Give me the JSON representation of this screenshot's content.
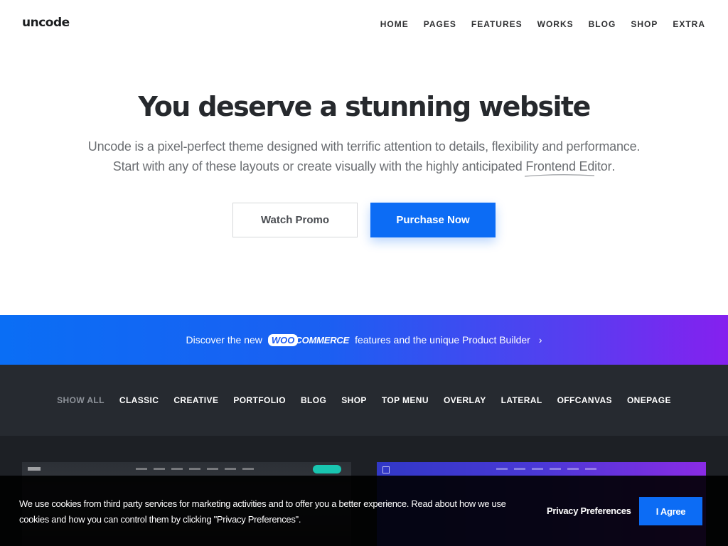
{
  "header": {
    "logo": "uncode",
    "nav": [
      "HOME",
      "PAGES",
      "FEATURES",
      "WORKS",
      "BLOG",
      "SHOP",
      "EXTRA"
    ]
  },
  "hero": {
    "title": "You deserve a stunning website",
    "line1": "Uncode is a pixel-perfect theme designed with terrific attention to details, flexibility and performance.",
    "line2_prefix": "Start with any of these layouts or create visually with the highly anticipated ",
    "line2_link": "Frontend Editor",
    "line2_suffix": ".",
    "btn_promo": "Watch Promo",
    "btn_purchase": "Purchase Now"
  },
  "banner": {
    "prefix": "Discover the new",
    "woo": "WOO",
    "commerce": "COMMERCE",
    "suffix": "features and the unique Product Builder",
    "chevron": "›"
  },
  "filters": [
    "SHOW ALL",
    "CLASSIC",
    "CREATIVE",
    "PORTFOLIO",
    "BLOG",
    "SHOP",
    "TOP MENU",
    "OVERLAY",
    "LATERAL",
    "OFFCANVAS",
    "ONEPAGE"
  ],
  "filter_active": "SHOW ALL",
  "cookie": {
    "text": "We use cookies from third party services for marketing activities and to offer you a better experience. Read about how we use cookies and how you can control them by clicking \"Privacy Preferences\".",
    "pref": "Privacy Preferences",
    "agree": "I Agree"
  },
  "colors": {
    "accent": "#0c6cf5",
    "dark": "#262a30",
    "banner_end": "#8520ef"
  }
}
